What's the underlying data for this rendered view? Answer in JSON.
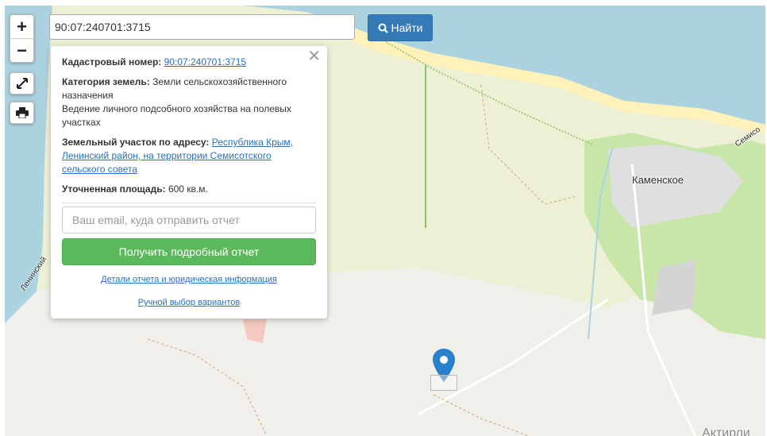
{
  "search": {
    "value": "90:07:240701:3715",
    "button_label": "Найти"
  },
  "zoom": {
    "in_label": "+",
    "out_label": "−"
  },
  "popup": {
    "cadastral_label": "Кадастровый номер:",
    "cadastral_value": "90:07:240701:3715",
    "category_label": "Категория земель:",
    "category_value": "Земли сельскохозяйственного назначения",
    "usage": "Ведение личного подсобного хозяйства на полевых участках",
    "address_label": "Земельный участок по адресу:",
    "address_value": "Республика Крым, Ленинский район, на территории Семисотского сельского совета",
    "area_label": "Уточненная площадь:",
    "area_value": "600 кв.м.",
    "email_placeholder": "Ваш email, куда отправить отчет",
    "report_button": "Получить подробный отчет",
    "details_link": "Детали отчета и юридическая информация",
    "manual_link": "Ручной выбор вариантов"
  },
  "map_labels": {
    "village": "Каменское",
    "road_left": "Ленинский",
    "road_right": "Семисо",
    "bottom_right": "Актирли"
  },
  "icons": {
    "search": "search-icon",
    "fullscreen": "fullscreen-icon",
    "print": "print-icon",
    "close": "close-icon",
    "marker": "map-marker-icon"
  },
  "colors": {
    "sea": "#aad3df",
    "land": "#f1efe9",
    "farmland": "#eef0d5",
    "beach": "#fff1ba",
    "green": "#c8e6a8",
    "marker": "#2a81cb",
    "primary": "#337ab7",
    "success": "#5cb85c"
  }
}
